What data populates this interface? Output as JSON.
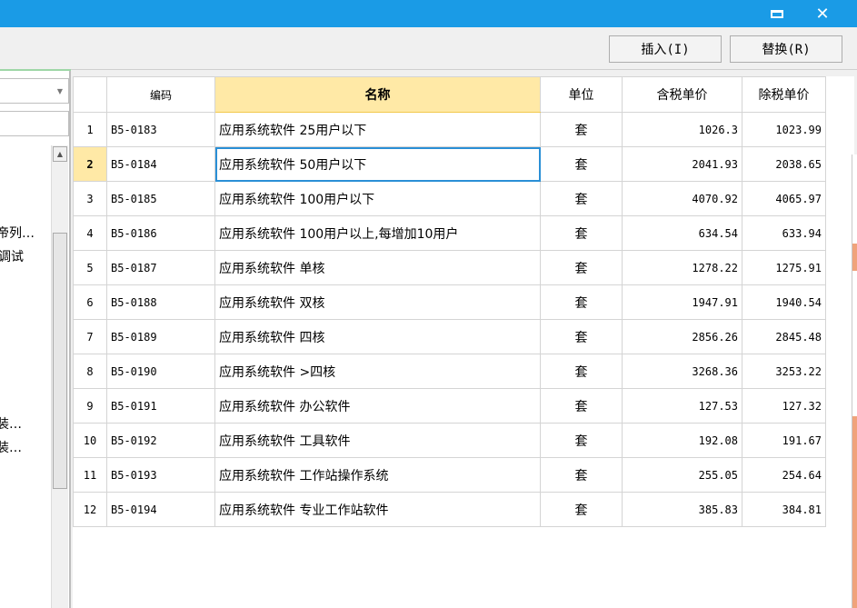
{
  "window": {
    "minimize_icon": "minimize-icon",
    "close_label": "✕",
    "titlebar_color": "#1a9be6"
  },
  "toolbar": {
    "insert_label": "插入(I)",
    "replace_label": "替换(R)"
  },
  "left_panel": {
    "tree_items": [
      "帝列…",
      "调试",
      "装…",
      "装…"
    ]
  },
  "table": {
    "headers": [
      "",
      "编码",
      "名称",
      "单位",
      "含税单价",
      "除税单价"
    ],
    "active_column": "名称",
    "selected_row": 2,
    "rows": [
      {
        "num": "1",
        "code": "B5-0183",
        "name": "应用系统软件 25用户以下",
        "unit": "套",
        "tax": "1026.3",
        "ntax": "1023.99"
      },
      {
        "num": "2",
        "code": "B5-0184",
        "name": "应用系统软件 50用户以下",
        "unit": "套",
        "tax": "2041.93",
        "ntax": "2038.65"
      },
      {
        "num": "3",
        "code": "B5-0185",
        "name": "应用系统软件 100用户以下",
        "unit": "套",
        "tax": "4070.92",
        "ntax": "4065.97"
      },
      {
        "num": "4",
        "code": "B5-0186",
        "name": "应用系统软件 100用户以上,每增加10用户",
        "unit": "套",
        "tax": "634.54",
        "ntax": "633.94"
      },
      {
        "num": "5",
        "code": "B5-0187",
        "name": "应用系统软件 单核",
        "unit": "套",
        "tax": "1278.22",
        "ntax": "1275.91"
      },
      {
        "num": "6",
        "code": "B5-0188",
        "name": "应用系统软件 双核",
        "unit": "套",
        "tax": "1947.91",
        "ntax": "1940.54"
      },
      {
        "num": "7",
        "code": "B5-0189",
        "name": "应用系统软件 四核",
        "unit": "套",
        "tax": "2856.26",
        "ntax": "2845.48"
      },
      {
        "num": "8",
        "code": "B5-0190",
        "name": "应用系统软件 >四核",
        "unit": "套",
        "tax": "3268.36",
        "ntax": "3253.22"
      },
      {
        "num": "9",
        "code": "B5-0191",
        "name": "应用系统软件 办公软件",
        "unit": "套",
        "tax": "127.53",
        "ntax": "127.32"
      },
      {
        "num": "10",
        "code": "B5-0192",
        "name": "应用系统软件 工具软件",
        "unit": "套",
        "tax": "192.08",
        "ntax": "191.67"
      },
      {
        "num": "11",
        "code": "B5-0193",
        "name": "应用系统软件 工作站操作系统",
        "unit": "套",
        "tax": "255.05",
        "ntax": "254.64"
      },
      {
        "num": "12",
        "code": "B5-0194",
        "name": "应用系统软件 专业工作站软件",
        "unit": "套",
        "tax": "385.83",
        "ntax": "384.81"
      }
    ]
  }
}
